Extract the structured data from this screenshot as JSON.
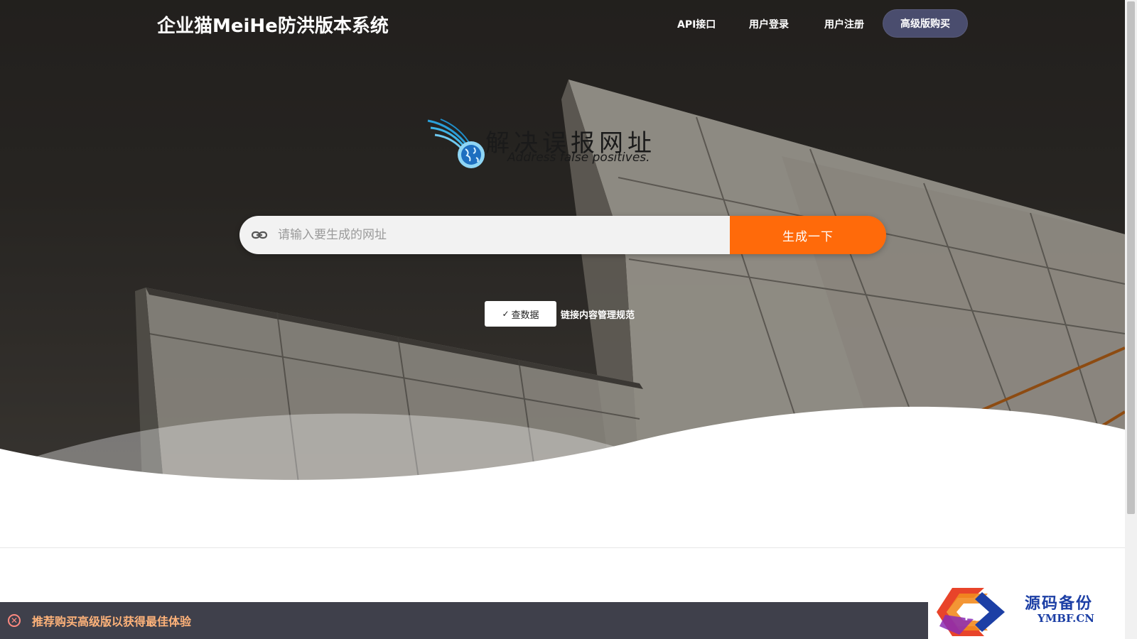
{
  "navbar": {
    "brand": "企业猫MeiHe防洪版本系统",
    "links": [
      {
        "label": "API接口"
      },
      {
        "label": "用户登录"
      },
      {
        "label": "用户注册"
      }
    ],
    "buy_label": "高级版购买"
  },
  "logo": {
    "title_cn": "解决误报网址",
    "subtitle_en": "Address false positives."
  },
  "search": {
    "placeholder": "请输入要生成的网址",
    "value": "",
    "button_label": "生成一下",
    "icon": "link-icon"
  },
  "actions": {
    "query_label": "查数据",
    "query_icon": "check-icon",
    "rules_label": "链接内容管理规范"
  },
  "notice": {
    "text": "推荐购买高级版以获得最佳体验",
    "close_icon": "close-circle-icon"
  },
  "watermark": {
    "text_cn": "源码备份",
    "text_en": "YMBF.CN",
    "glyph": "码"
  },
  "colors": {
    "accent_orange": "#ff6a0a",
    "buy_button": "#4a4d6e",
    "notice_bar": "#3f404b",
    "notice_text": "#ffb37a"
  }
}
